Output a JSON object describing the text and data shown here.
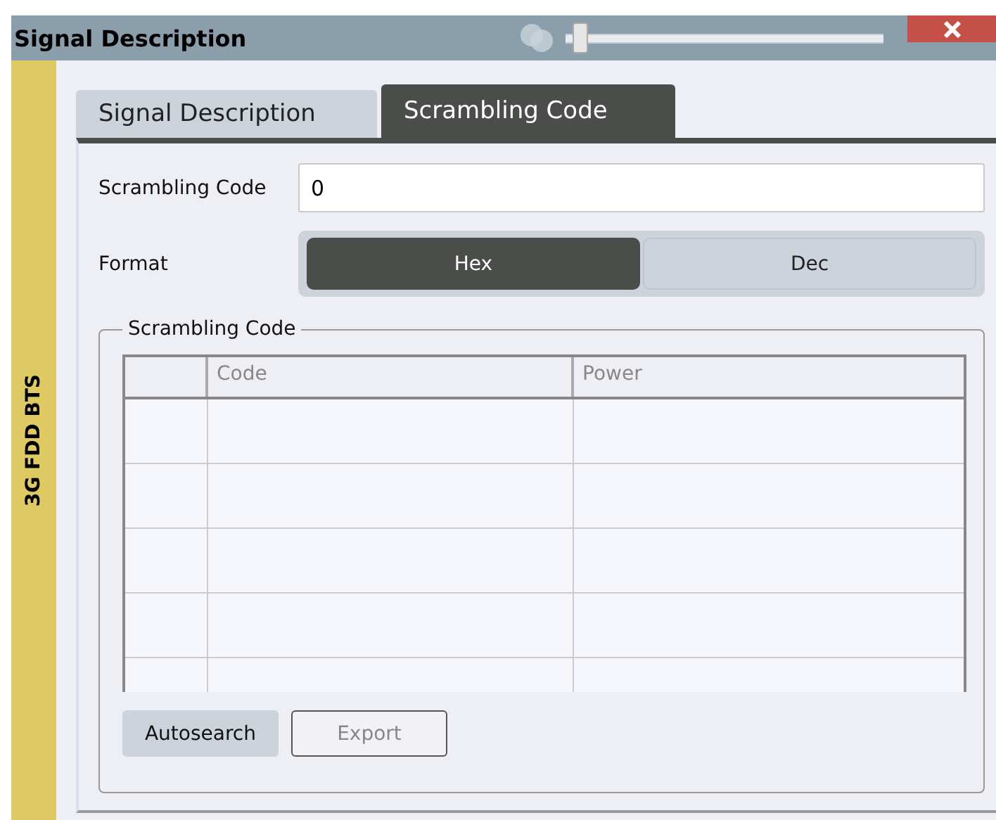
{
  "window": {
    "title": "Signal Description"
  },
  "transparency_slider": {
    "level": 0.02
  },
  "sidebar": {
    "label": "3G FDD BTS"
  },
  "tabs": [
    {
      "label": "Signal Description",
      "selected": false
    },
    {
      "label": "Scrambling Code",
      "selected": true
    }
  ],
  "scrambling_code": {
    "label": "Scrambling Code",
    "value": "0"
  },
  "format": {
    "label": "Format",
    "options": [
      {
        "label": "Hex",
        "selected": true
      },
      {
        "label": "Dec",
        "selected": false
      }
    ]
  },
  "group": {
    "title": "Scrambling Code"
  },
  "table": {
    "columns": [
      "Code",
      "Power"
    ]
  },
  "buttons": [
    {
      "label": "Autosearch",
      "disabled": false
    },
    {
      "label": "Export",
      "disabled": true
    }
  ]
}
